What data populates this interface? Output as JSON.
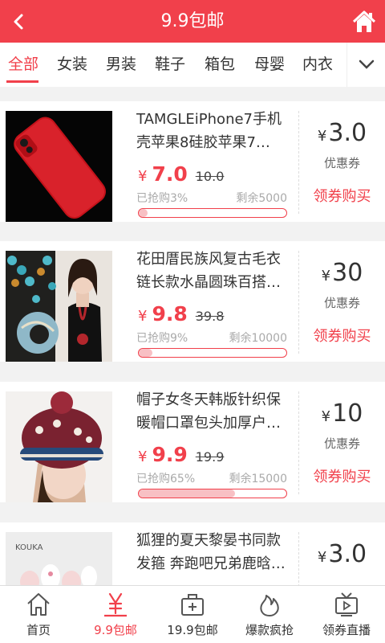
{
  "header": {
    "title": "9.9包邮"
  },
  "categories": [
    "全部",
    "女装",
    "男装",
    "鞋子",
    "箱包",
    "母婴",
    "内衣"
  ],
  "products": [
    {
      "name": "TAMGLEiPhone7手机壳苹果8硅胶苹果7…",
      "price_symbol": "¥",
      "price": "7.0",
      "original_price": "10.0",
      "sold_text": "已抢购3%",
      "remaining_text": "剩余5000",
      "progress_percent": 3,
      "coupon_symbol": "¥",
      "coupon_value": "3.0",
      "coupon_label": "优惠券",
      "coupon_button": "领券购买"
    },
    {
      "name": "花田厝民族风复古毛衣链长款水晶圆珠百搭…",
      "price_symbol": "¥",
      "price": "9.8",
      "original_price": "39.8",
      "sold_text": "已抢购9%",
      "remaining_text": "剩余10000",
      "progress_percent": 9,
      "coupon_symbol": "¥",
      "coupon_value": "30",
      "coupon_label": "优惠券",
      "coupon_button": "领券购买"
    },
    {
      "name": "帽子女冬天韩版针织保暖帽口罩包头加厚户…",
      "price_symbol": "¥",
      "price": "9.9",
      "original_price": "19.9",
      "sold_text": "已抢购65%",
      "remaining_text": "剩余15000",
      "progress_percent": 65,
      "coupon_symbol": "¥",
      "coupon_value": "10",
      "coupon_label": "优惠券",
      "coupon_button": "领券购买"
    },
    {
      "name": "狐狸的夏天黎晏书同款发箍 奔跑吧兄弟鹿晗…",
      "price_symbol": "¥",
      "price": "",
      "original_price": "",
      "sold_text": "",
      "remaining_text": "",
      "progress_percent": 0,
      "coupon_symbol": "¥",
      "coupon_value": "3.0",
      "coupon_label": "",
      "coupon_button": "",
      "brand_text": "KOUKA"
    }
  ],
  "tabbar": [
    {
      "label": "首页",
      "icon": "home-icon"
    },
    {
      "label": "9.9包邮",
      "icon": "yen-icon"
    },
    {
      "label": "19.9包邮",
      "icon": "package-icon"
    },
    {
      "label": "爆款疯抢",
      "icon": "flame-icon"
    },
    {
      "label": "领券直播",
      "icon": "tv-icon"
    }
  ],
  "colors": {
    "accent": "#f1404b",
    "background": "#f2f2f2"
  }
}
